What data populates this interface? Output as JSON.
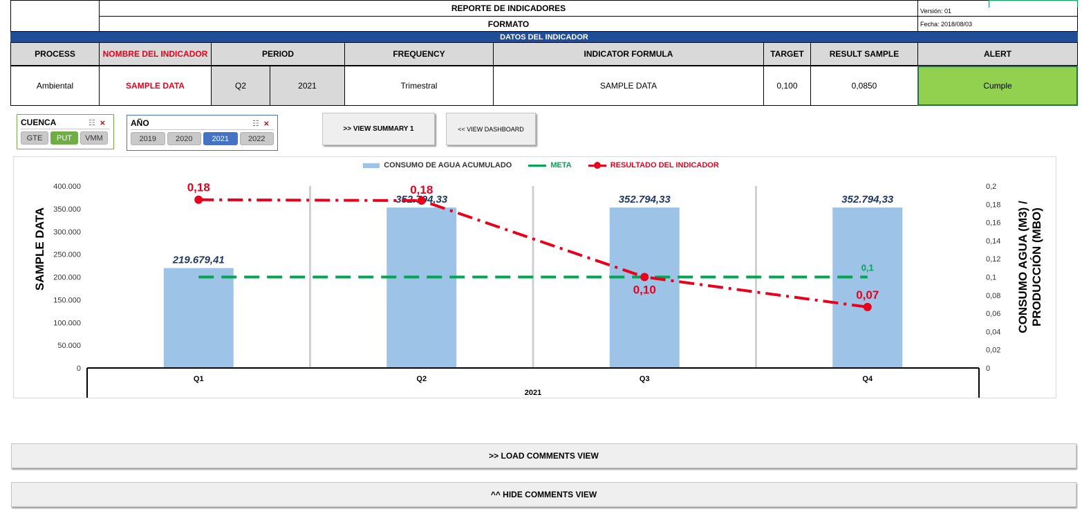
{
  "header": {
    "title": "REPORTE DE INDICADORES",
    "subtitle": "FORMATO",
    "version": "Versión: 01",
    "date": "Fecha: 2018/08/03",
    "band": "DATOS DEL INDICADOR"
  },
  "table": {
    "headers": {
      "process": "PROCESS",
      "name": "NOMBRE DEL INDICADOR",
      "period": "PERIOD",
      "frequency": "FREQUENCY",
      "formula": "INDICATOR FORMULA",
      "target": "TARGET",
      "result": "RESULT SAMPLE",
      "alert": "ALERT"
    },
    "row": {
      "process": "Ambiental",
      "name": "SAMPLE DATA",
      "quarter": "Q2",
      "year": "2021",
      "frequency": "Trimestral",
      "formula": "SAMPLE DATA",
      "target": "0,100",
      "result": "0,0850",
      "alert": "Cumple"
    },
    "alert_color": "#92d050"
  },
  "slicers": {
    "cuenca": {
      "title": "CUENCA",
      "options": [
        "GTE",
        "PUT",
        "VMM"
      ],
      "selected": "PUT",
      "accent": "#70ad47"
    },
    "anio": {
      "title": "AÑO",
      "options": [
        "2019",
        "2020",
        "2021",
        "2022"
      ],
      "selected": "2021",
      "accent": "#4472c4"
    }
  },
  "buttons": {
    "summary": ">> VIEW SUMMARY 1",
    "dashboard": "<< VIEW DASHBOARD",
    "load_comments": ">> LOAD COMMENTS  VIEW",
    "hide_comments": "^^ HIDE COMMENTS VIEW"
  },
  "chart_data": {
    "type": "bar",
    "categories": [
      "Q1",
      "Q2",
      "Q3",
      "Q4"
    ],
    "group_label": "2021",
    "series": [
      {
        "name": "CONSUMO DE AGUA ACUMULADO",
        "kind": "bar",
        "axis": "left",
        "color": "#9dc3e6",
        "values": [
          219679.41,
          352794.33,
          352794.33,
          352794.33
        ],
        "labels": [
          "219.679,41",
          "352.794,33",
          "352.794,33",
          "352.794,33"
        ]
      },
      {
        "name": "META",
        "kind": "line",
        "axis": "right",
        "color": "#00a651",
        "values": [
          0.1,
          0.1,
          0.1,
          0.1
        ],
        "labels": [
          "",
          "",
          "",
          "0,1"
        ]
      },
      {
        "name": "RESULTADO DEL INDICADOR",
        "kind": "line",
        "axis": "right",
        "color": "#e8001c",
        "values": [
          0.185,
          0.184,
          0.1,
          0.067
        ],
        "labels": [
          "0,18",
          "0,18",
          "0,10",
          "0,07"
        ]
      }
    ],
    "ylabel": "SAMPLE DATA",
    "y2label": "CONSUMO AGUA (M3) / PRODUCCIÓN (MBO)",
    "ylim": [
      0,
      400000
    ],
    "y2lim": [
      0,
      0.2
    ],
    "yticks": [
      "0",
      "50.000",
      "100.000",
      "150.000",
      "200.000",
      "250.000",
      "300.000",
      "350.000",
      "400.000"
    ],
    "y2ticks": [
      "0",
      "0,02",
      "0,04",
      "0,06",
      "0,08",
      "0,1",
      "0,12",
      "0,14",
      "0,16",
      "0,18",
      "0,2"
    ],
    "legend": "top",
    "grid": false
  }
}
